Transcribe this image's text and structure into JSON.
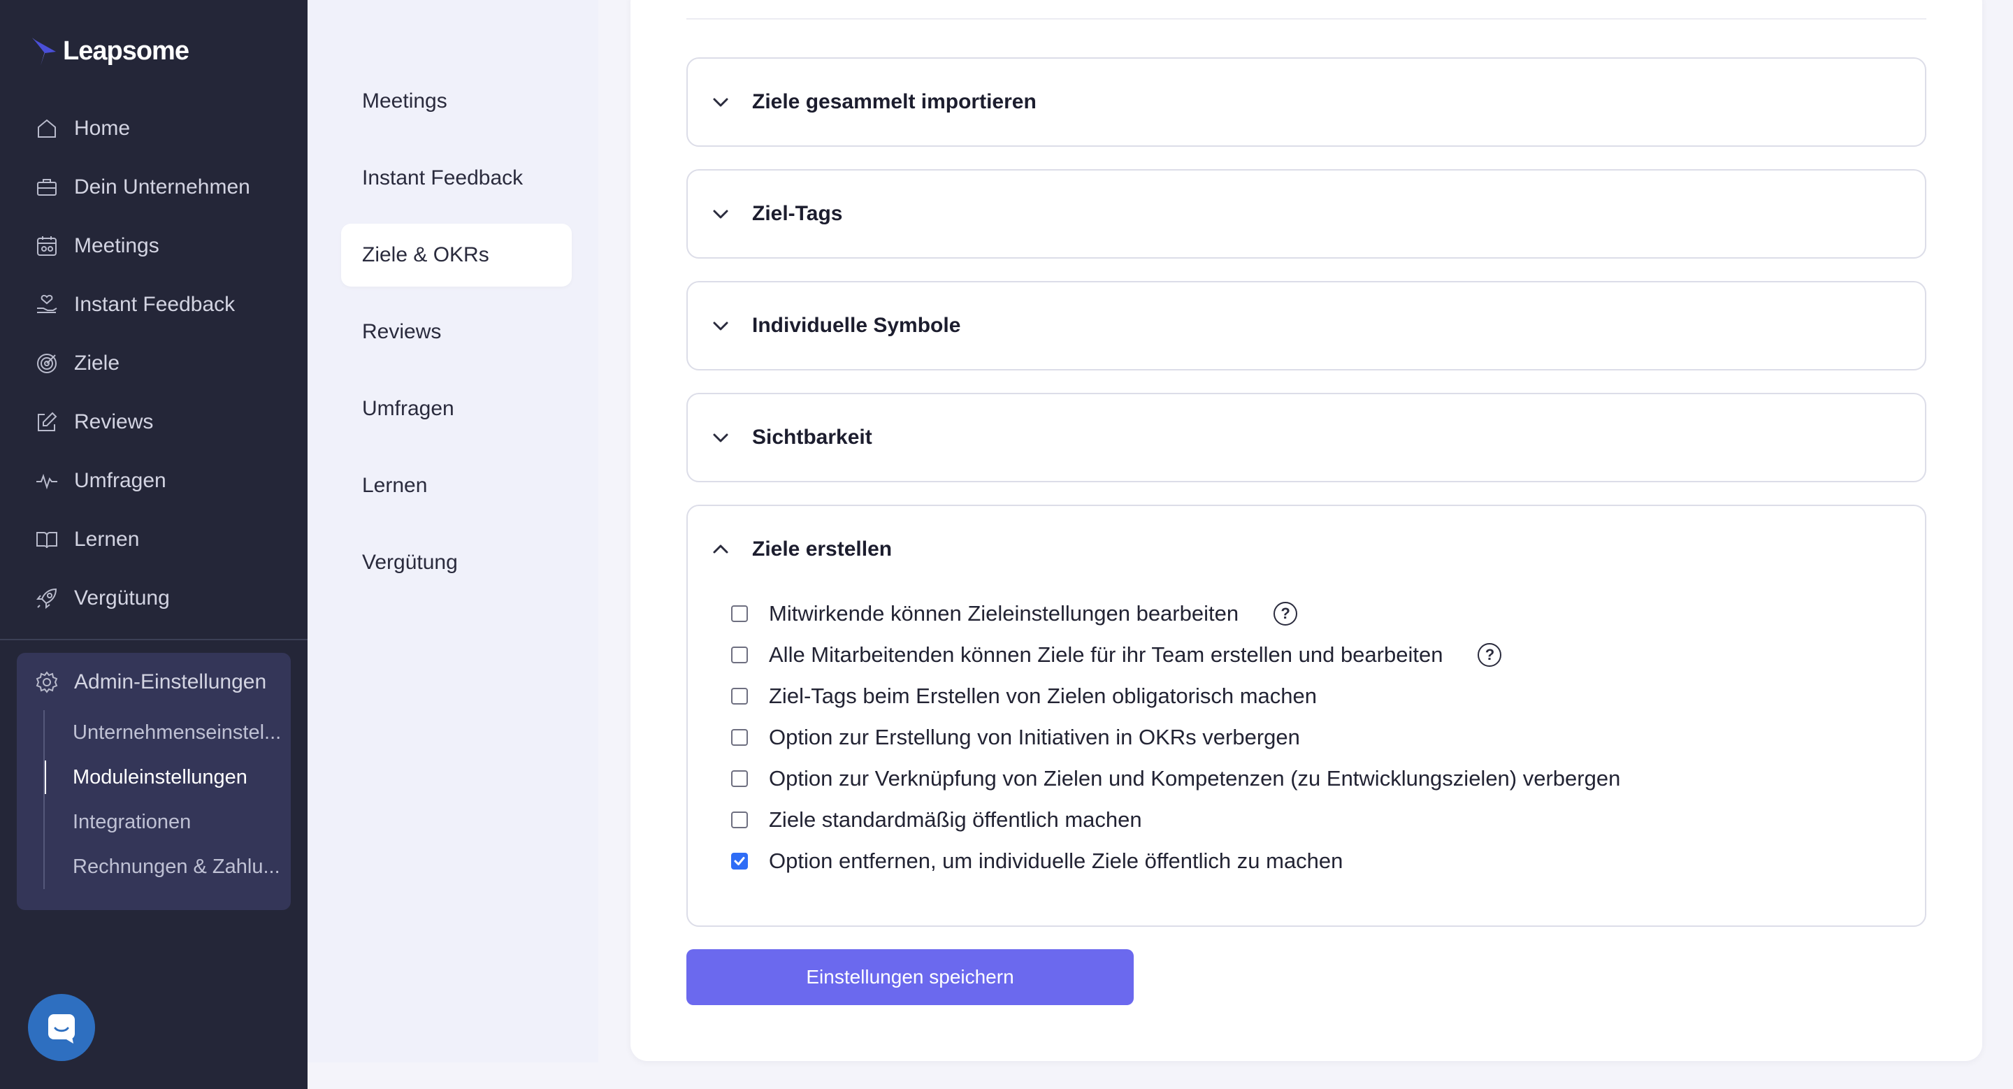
{
  "app": {
    "name": "Leapsome"
  },
  "sidebar": {
    "items": [
      {
        "label": "Home",
        "icon": "home-icon"
      },
      {
        "label": "Dein Unternehmen",
        "icon": "briefcase-icon"
      },
      {
        "label": "Meetings",
        "icon": "calendar-people-icon"
      },
      {
        "label": "Instant Feedback",
        "icon": "hand-heart-icon"
      },
      {
        "label": "Ziele",
        "icon": "target-icon"
      },
      {
        "label": "Reviews",
        "icon": "edit-icon"
      },
      {
        "label": "Umfragen",
        "icon": "pulse-icon"
      },
      {
        "label": "Lernen",
        "icon": "book-icon"
      },
      {
        "label": "Vergütung",
        "icon": "rocket-icon"
      }
    ],
    "admin": {
      "label": "Admin-Einstellungen",
      "icon": "gear-icon",
      "subitems": [
        {
          "label": "Unternehmenseinstel..."
        },
        {
          "label": "Moduleinstellungen",
          "active": true
        },
        {
          "label": "Integrationen"
        },
        {
          "label": "Rechnungen & Zahlu..."
        }
      ]
    },
    "chat_icon": "chat-icon"
  },
  "subnav": {
    "items": [
      {
        "label": "Meetings"
      },
      {
        "label": "Instant Feedback"
      },
      {
        "label": "Ziele & OKRs",
        "active": true
      },
      {
        "label": "Reviews"
      },
      {
        "label": "Umfragen"
      },
      {
        "label": "Lernen"
      },
      {
        "label": "Vergütung"
      }
    ]
  },
  "sections": [
    {
      "title": "Ziele gesammelt importieren",
      "expanded": false
    },
    {
      "title": "Ziel-Tags",
      "expanded": false
    },
    {
      "title": "Individuelle Symbole",
      "expanded": false
    },
    {
      "title": "Sichtbarkeit",
      "expanded": false
    },
    {
      "title": "Ziele erstellen",
      "expanded": true,
      "options": [
        {
          "label": "Mitwirkende können Zieleinstellungen bearbeiten",
          "checked": false,
          "help": true
        },
        {
          "label": "Alle Mitarbeitenden können Ziele für ihr Team erstellen und bearbeiten",
          "checked": false,
          "help": true
        },
        {
          "label": "Ziel-Tags beim Erstellen von Zielen obligatorisch machen",
          "checked": false,
          "help": false
        },
        {
          "label": "Option zur Erstellung von Initiativen in OKRs verbergen",
          "checked": false,
          "help": false
        },
        {
          "label": "Option zur Verknüpfung von Zielen und Kompetenzen (zu Entwicklungszielen) verbergen",
          "checked": false,
          "help": false
        },
        {
          "label": "Ziele standardmäßig öffentlich machen",
          "checked": false,
          "help": false
        },
        {
          "label": "Option entfernen, um individuelle Ziele öffentlich zu machen",
          "checked": true,
          "help": false
        }
      ]
    }
  ],
  "help_glyph": "?",
  "save_label": "Einstellungen speichern",
  "colors": {
    "sidebar": "#242638",
    "admin_box": "#343658",
    "accent": "#6b69ee",
    "checkbox": "#2f6df6"
  }
}
